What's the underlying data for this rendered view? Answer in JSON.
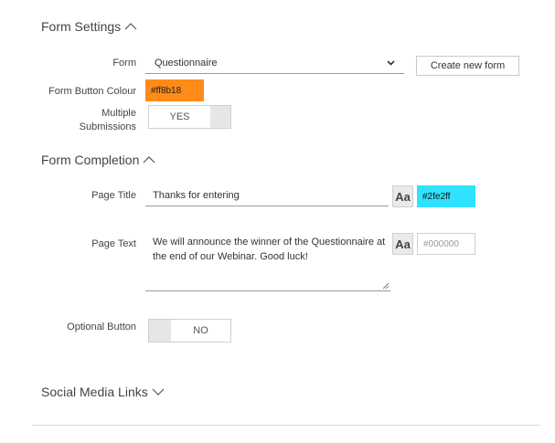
{
  "form_settings": {
    "title": "Form Settings",
    "form_label": "Form",
    "form_value": "Questionnaire",
    "create_button": "Create new form",
    "button_colour_label": "Form Button Colour",
    "button_colour_value": "#ff8b18",
    "button_colour_hex": "#ff8b18",
    "multiple_label_line1": "Multiple",
    "multiple_label_line2": "Submissions",
    "multiple_toggle": "YES"
  },
  "form_completion": {
    "title": "Form Completion",
    "page_title_label": "Page Title",
    "page_title_value": "Thanks for entering",
    "page_title_font_button": "Aa",
    "page_title_colour": "#2fe2ff",
    "page_title_colour_hex": "#2fe2ff",
    "page_text_label": "Page Text",
    "page_text_value": "We will announce the winner of the Questionnaire at the end of our Webinar. Good luck!",
    "page_text_font_button": "Aa",
    "page_text_colour_placeholder": "#000000",
    "optional_button_label": "Optional Button",
    "optional_toggle": "NO"
  },
  "social": {
    "title": "Social Media Links"
  },
  "icons": {
    "chevron_up": "chevron-up-icon",
    "chevron_down": "chevron-down-icon"
  }
}
